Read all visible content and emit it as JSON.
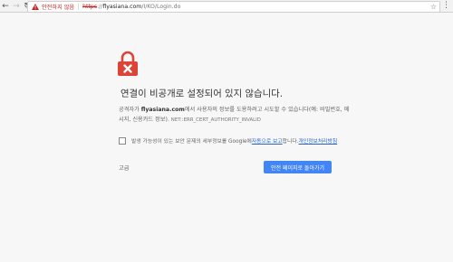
{
  "colors": {
    "accent": "#4285f4",
    "danger": "#db4437",
    "link": "#2563c9"
  },
  "toolbar": {
    "back_icon": "arrow-left-icon",
    "forward_icon": "arrow-right-icon",
    "reload_icon": "reload-icon",
    "security_label": "안전하지 않음",
    "url_scheme": "https",
    "url_host": "flyasiana.com",
    "url_path": "/I/KO/Login.do",
    "star_icon": "star-icon",
    "menu_icon": "kebab-menu-icon"
  },
  "error": {
    "icon": "broken-lock-icon",
    "title": "연결이 비공개로 설정되어 있지 않습니다.",
    "desc_prefix": "공격자가 ",
    "desc_host": "flyasiana.com",
    "desc_suffix": "에서 사용자의 정보를 도용하려고 시도할 수 있습니다(예: 비밀번호, 메시지, 신용카드 정보).",
    "error_code": "NET::ERR_CERT_AUTHORITY_INVALID"
  },
  "report": {
    "text_before": "발생 가능성이 있는 보안 문제의 세부정보를 Google에 ",
    "link1": "자동으로 보고",
    "text_middle": "합니다. ",
    "link2": "개인정보처리방침"
  },
  "actions": {
    "advanced": "고급",
    "back_to_safety": "안전 페이지로 돌아가기"
  }
}
